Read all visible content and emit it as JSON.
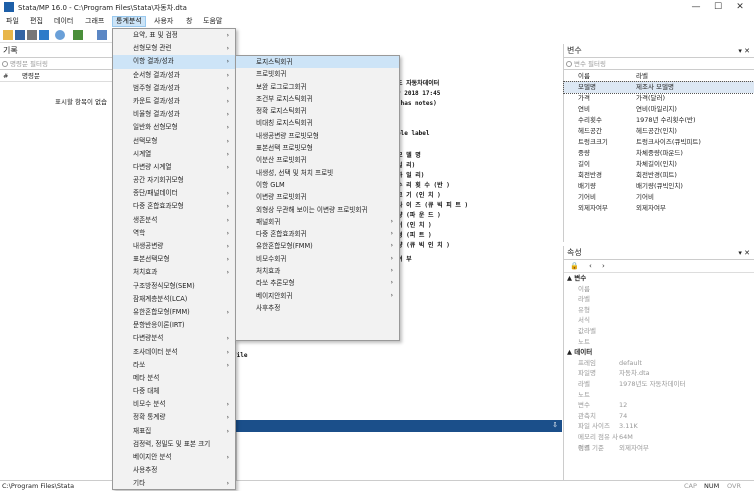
{
  "window": {
    "title": "Stata/MP 16.0 - C:\\Program Files\\Stata\\자동차.dta",
    "app_icon": "Stata"
  },
  "window_controls": {
    "minimize": "—",
    "maximize": "☐",
    "close": "✕"
  },
  "menubar": [
    "파일",
    "편집",
    "데이터",
    "그래프",
    "통계분석",
    "사용자",
    "창",
    "도움말"
  ],
  "left_panel": {
    "title": "기록",
    "filter_placeholder": "명령문 필터링",
    "col_num": "#",
    "col_cmd": "명령문",
    "empty_text": "표시할 항목이 없습"
  },
  "results": {
    "lines": [
      "도 자동차데이터",
      "r 2018 17:45",
      " has notes)",
      "ble label",
      "모 델 명",
      "일 리)",
      "하 일 리)",
      "수 리 횟 수 (반 )",
      "크 기 (인 치 )",
      "사 이 즈 (큐 빅 피 트 )",
      "량 (파 운 드 )",
      "이 (인 치 )",
      "경 (피 트 )",
      "량 (큐 빅 인 치 )",
      "여 부",
      "file"
    ]
  },
  "command_bar": {
    "pin": "⇩"
  },
  "stats_menu": [
    {
      "label": "요약, 표 및 검정",
      "sub": true
    },
    {
      "label": "선형모형 관련",
      "sub": true
    },
    {
      "label": "이항 결과/성과",
      "sub": true,
      "active": true
    },
    {
      "label": "순서형 결과/성과",
      "sub": true
    },
    {
      "label": "범주형 결과/성과",
      "sub": true
    },
    {
      "label": "카운트 결과/성과",
      "sub": true
    },
    {
      "label": "비율형 결과/성과",
      "sub": true
    },
    {
      "label": "일반화 선형모형",
      "sub": true
    },
    {
      "label": "선택모형",
      "sub": true
    },
    {
      "label": "시계열",
      "sub": true
    },
    {
      "label": "다변량 시계열",
      "sub": true
    },
    {
      "label": "공간 자기회귀모형",
      "sub": false
    },
    {
      "label": "종단/패널데이터",
      "sub": true
    },
    {
      "label": "다중 혼합효과모형",
      "sub": true
    },
    {
      "label": "생존분석",
      "sub": true
    },
    {
      "label": "역학",
      "sub": true
    },
    {
      "label": "내생공변량",
      "sub": true
    },
    {
      "label": "표본선택모형",
      "sub": true
    },
    {
      "label": "처치효과",
      "sub": true
    },
    {
      "label": "구조방정식모형(SEM)",
      "sub": false
    },
    {
      "label": "잠재계층분석(LCA)",
      "sub": false
    },
    {
      "label": "유한혼합모형(FMM)",
      "sub": true
    },
    {
      "label": "문항반응이론(IRT)",
      "sub": false
    },
    {
      "label": "다변량분석",
      "sub": true
    },
    {
      "label": "조사데이터 분석",
      "sub": true
    },
    {
      "label": "라쏘",
      "sub": true
    },
    {
      "label": "메타 분석",
      "sub": false
    },
    {
      "label": "다중 대체",
      "sub": false
    },
    {
      "label": "비모수 분석",
      "sub": true
    },
    {
      "label": "정확 통계량",
      "sub": true
    },
    {
      "label": "재표집",
      "sub": true
    },
    {
      "label": "검정력, 정밀도 및 표본 크기",
      "sub": false
    },
    {
      "label": "베이지안 분석",
      "sub": true
    },
    {
      "label": "사용추정",
      "sub": false
    },
    {
      "label": "기타",
      "sub": true
    }
  ],
  "binary_menu": [
    {
      "label": "로지스틱회귀",
      "sub": false,
      "active": true
    },
    {
      "label": "프로빗회귀",
      "sub": false
    },
    {
      "label": "보완 로그로그회귀",
      "sub": false
    },
    {
      "label": "조건부 로지스틱회귀",
      "sub": false
    },
    {
      "label": "정확 로지스틱회귀",
      "sub": false
    },
    {
      "label": "비대칭 로지스틱회귀",
      "sub": false
    },
    {
      "label": "내생공변량 프로빗모형",
      "sub": false
    },
    {
      "label": "표본선택 프로빗모형",
      "sub": false
    },
    {
      "label": "이분산 프로빗회귀",
      "sub": false
    },
    {
      "label": "내생성, 선택 및 처치 프로빗",
      "sub": false
    },
    {
      "label": "이항 GLM",
      "sub": false
    },
    {
      "label": "이변량 프로빗회귀",
      "sub": false
    },
    {
      "label": "외형상 무관해 보이는 이변량 프로빗회귀",
      "sub": false
    },
    {
      "label": "패널회귀",
      "sub": true
    },
    {
      "label": "다중 혼합효과회귀",
      "sub": true
    },
    {
      "label": "유한혼합모형(FMM)",
      "sub": true
    },
    {
      "label": "비모수회귀",
      "sub": true
    },
    {
      "label": "처치효과",
      "sub": true
    },
    {
      "label": "라쏘 추론모형",
      "sub": true
    },
    {
      "label": "베이지안회귀",
      "sub": true
    },
    {
      "label": "사후추정",
      "sub": false
    }
  ],
  "variables": {
    "title": "변수",
    "filter_placeholder": "변수 필터링",
    "col_name": "이름",
    "col_label": "라벨",
    "rows": [
      {
        "name": "모델명",
        "label": "제조사 모델명",
        "selected": true
      },
      {
        "name": "가격",
        "label": "가격(달러)"
      },
      {
        "name": "연비",
        "label": "연비(마일리지)"
      },
      {
        "name": "수리횟수",
        "label": "1978년 수리횟수(반)"
      },
      {
        "name": "헤드공간",
        "label": "헤드공간(인치)"
      },
      {
        "name": "트렁크크기",
        "label": "트렁크사이즈(큐빅피트)"
      },
      {
        "name": "중량",
        "label": "차체중량(파운드)"
      },
      {
        "name": "길이",
        "label": "차체길이(인치)"
      },
      {
        "name": "회전반경",
        "label": "회전반경(피트)"
      },
      {
        "name": "배기량",
        "label": "배기량(큐빅인치)"
      },
      {
        "name": "기어비",
        "label": "기어비"
      },
      {
        "name": "외제자여부",
        "label": "외제자여부"
      }
    ]
  },
  "properties": {
    "title": "속성",
    "sections": [
      {
        "title": "▲ 변수",
        "rows": [
          [
            "이름",
            ""
          ],
          [
            "라벨",
            ""
          ],
          [
            "유형",
            ""
          ],
          [
            "서식",
            ""
          ],
          [
            "값라벨",
            ""
          ],
          [
            "노트",
            ""
          ]
        ]
      },
      {
        "title": "▲ 데이터",
        "rows": [
          [
            "프레임",
            "default"
          ],
          [
            "파일명",
            "자동차.dta"
          ],
          [
            "라벨",
            "1978년도 자동차데이터"
          ],
          [
            "노트",
            ""
          ],
          [
            "변수",
            "12"
          ],
          [
            "관측치",
            "74"
          ],
          [
            "파일 사이즈",
            "3.11K"
          ],
          [
            "메모리 점유 사이즈",
            "64M"
          ],
          [
            "정렬 기준",
            "외제자여부"
          ]
        ]
      }
    ]
  },
  "statusbar": {
    "path": "C:\\Program Files\\Stata",
    "cap": "CAP",
    "num": "NUM",
    "ovr": "OVR"
  },
  "colors": {
    "accent": "#1b4f8a",
    "menu_highlight": "#cde4f7"
  }
}
